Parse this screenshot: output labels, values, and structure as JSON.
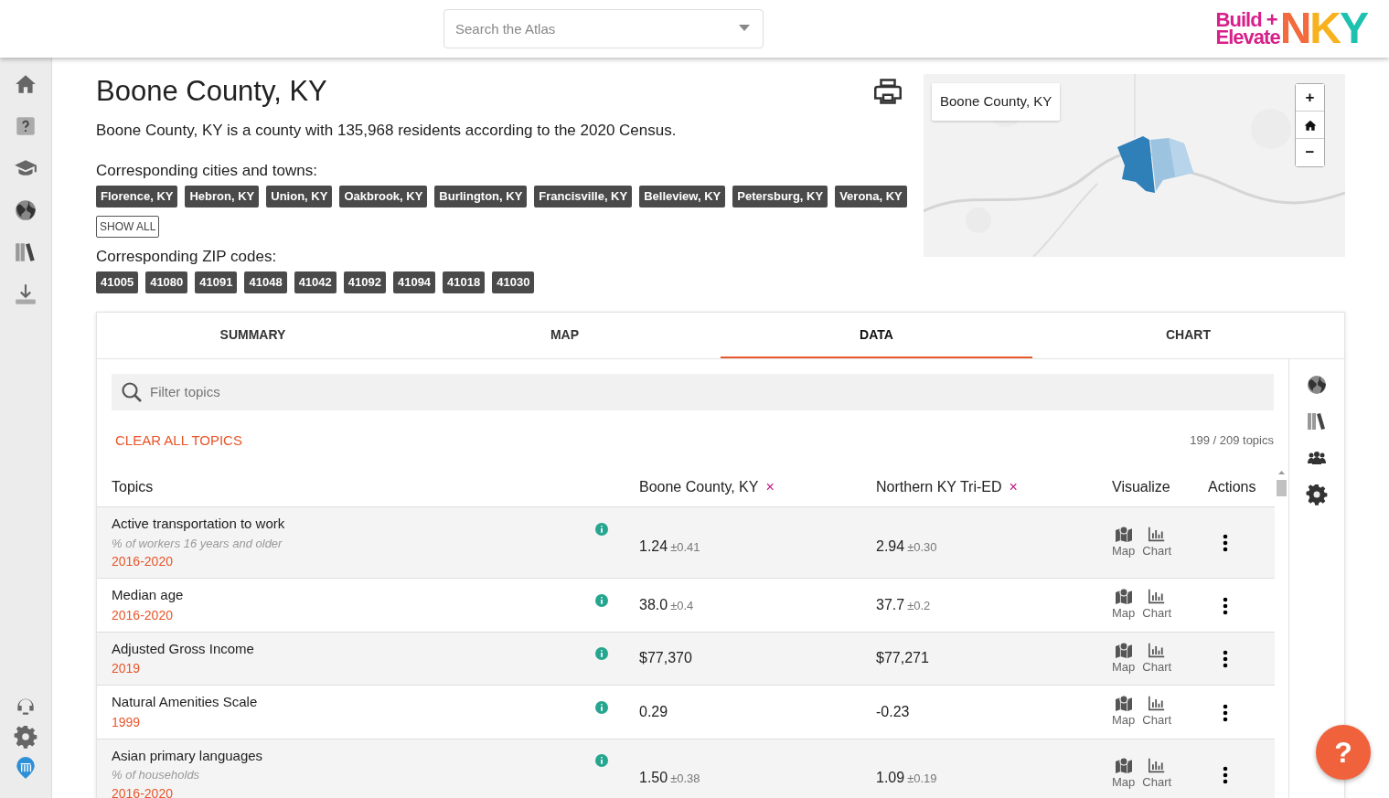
{
  "header": {
    "search": {
      "placeholder": "Search the Atlas"
    },
    "logo": {
      "line1": "Build +",
      "line2": "Elevate",
      "letters": [
        {
          "text": "N",
          "color": "#f26a3d"
        },
        {
          "text": "K",
          "color": "#f7b21e"
        },
        {
          "text": "Y",
          "color": "#1cc2ae"
        }
      ]
    }
  },
  "sidebar": {
    "items": [
      {
        "kind": "home"
      },
      {
        "kind": "help"
      },
      {
        "kind": "learn"
      },
      {
        "kind": "globe"
      },
      {
        "kind": "library"
      },
      {
        "kind": "download"
      }
    ],
    "bottom": [
      {
        "kind": "support"
      },
      {
        "kind": "settings"
      },
      {
        "kind": "brand"
      }
    ]
  },
  "place": {
    "title": "Boone County, KY",
    "description": "Boone County, KY is a county with 135,968 residents according to the 2020 Census.",
    "cities_label": "Corresponding cities and towns:",
    "cities": [
      "Florence, KY",
      "Hebron, KY",
      "Union, KY",
      "Oakbrook, KY",
      "Burlington, KY",
      "Francisville, KY",
      "Belleview, KY",
      "Petersburg, KY",
      "Verona, KY"
    ],
    "show_all": "SHOW ALL",
    "zips_label": "Corresponding ZIP codes:",
    "zips": [
      "41005",
      "41080",
      "41091",
      "41048",
      "41042",
      "41092",
      "41094",
      "41018",
      "41030"
    ]
  },
  "map": {
    "kind": "picture",
    "tooltip": "Boone County, KY",
    "controls": [
      "+",
      "−"
    ]
  },
  "tabs": [
    {
      "label": "SUMMARY",
      "selected": false
    },
    {
      "label": "MAP",
      "selected": false
    },
    {
      "label": "DATA",
      "selected": true
    },
    {
      "label": "CHART",
      "selected": false
    }
  ],
  "data": {
    "filter": {
      "placeholder": "Filter topics"
    },
    "clear_all": "CLEAR ALL TOPICS",
    "count": "199 / 209 topics",
    "columns": [
      {
        "label": "Topics"
      },
      {
        "label": "Boone County, KY",
        "remove": "×"
      },
      {
        "label": "Northern KY Tri-ED",
        "remove": "×"
      },
      {
        "label": "Visualize"
      },
      {
        "label": "Actions"
      }
    ],
    "rows": [
      {
        "topic": "Active transportation to work",
        "subtitle": "% of workers 16 years and older",
        "years": "2016-2020",
        "values": [
          {
            "value": "1.24",
            "moe": "±0.41"
          },
          {
            "value": "2.94",
            "moe": "±0.30"
          }
        ],
        "visualize": [
          "Map",
          "Chart"
        ]
      },
      {
        "topic": "Median age",
        "years": "2016-2020",
        "values": [
          {
            "value": "38.0",
            "moe": "±0.4"
          },
          {
            "value": "37.7",
            "moe": "±0.2"
          }
        ],
        "visualize": [
          "Map",
          "Chart"
        ]
      },
      {
        "topic": "Adjusted Gross Income",
        "years": "2019",
        "values": [
          {
            "value": "$77,370"
          },
          {
            "value": "$77,271"
          }
        ],
        "visualize": [
          "Map",
          "Chart"
        ]
      },
      {
        "topic": "Natural Amenities Scale",
        "years": "1999",
        "values": [
          {
            "value": "0.29"
          },
          {
            "value": "-0.23"
          }
        ],
        "visualize": [
          "Map",
          "Chart"
        ]
      },
      {
        "topic": "Asian primary languages",
        "subtitle": "% of households",
        "years": "2016-2020",
        "values": [
          {
            "value": "1.50",
            "moe": "±0.38"
          },
          {
            "value": "1.09",
            "moe": "±0.19"
          }
        ],
        "visualize": [
          "Map",
          "Chart"
        ]
      }
    ]
  },
  "rail": [
    {
      "kind": "globe"
    },
    {
      "kind": "library"
    },
    {
      "kind": "people"
    },
    {
      "kind": "settings"
    }
  ],
  "help_button": "?"
}
